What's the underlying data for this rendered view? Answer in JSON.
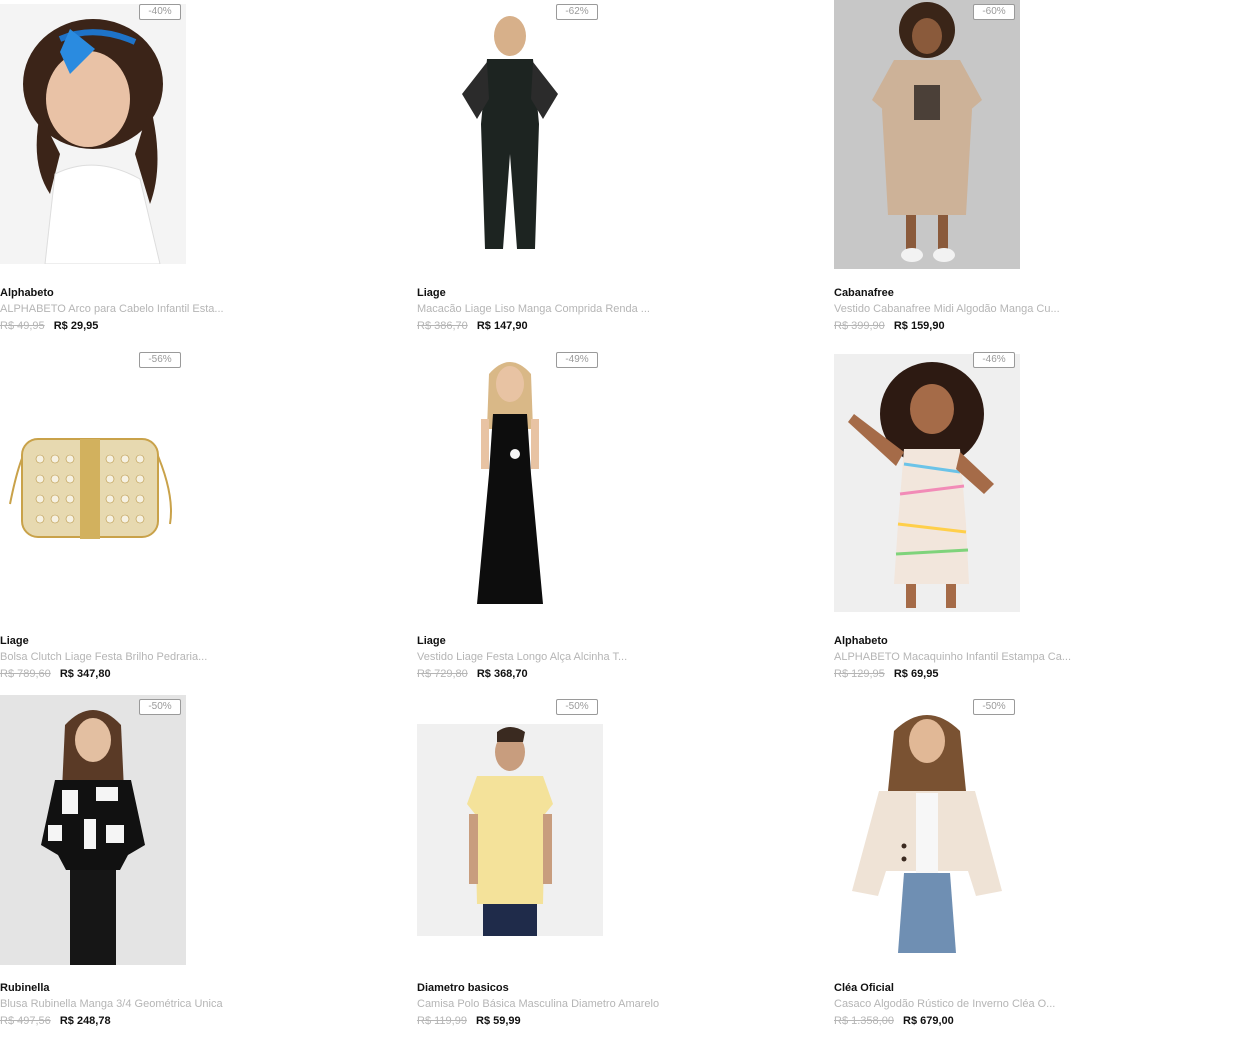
{
  "products": [
    {
      "brand": "Alphabeto",
      "name": "ALPHABETO Arco para Cabelo Infantil Esta...",
      "old_price": "R$ 49,95",
      "price": "R$ 29,95",
      "discount": "-40%",
      "image": "girl-blue-bow-photo",
      "bg": "#f3f3f3"
    },
    {
      "brand": "Liage",
      "name": "Macacão Liage Liso Manga Comprida Renda ...",
      "old_price": "R$ 386,70",
      "price": "R$ 147,90",
      "discount": "-62%",
      "image": "black-jumpsuit-photo",
      "bg": "#ffffff"
    },
    {
      "brand": "Cabanafree",
      "name": "Vestido Cabanafree Midi Algodão Manga Cu...",
      "old_price": "R$ 399,90",
      "price": "R$ 159,90",
      "discount": "-60%",
      "image": "beige-tshirt-dress-photo",
      "bg": "#c9c9c9"
    },
    {
      "brand": "Liage",
      "name": "Bolsa Clutch Liage Festa Brilho Pedraria...",
      "old_price": "R$ 789,60",
      "price": "R$ 347,80",
      "discount": "-56%",
      "image": "pearl-clutch-photo",
      "bg": "#ffffff"
    },
    {
      "brand": "Liage",
      "name": "Vestido Liage Festa Longo Alça Alcinha T...",
      "old_price": "R$ 729,80",
      "price": "R$ 368,70",
      "discount": "-49%",
      "image": "black-long-dress-photo",
      "bg": "#ffffff"
    },
    {
      "brand": "Alphabeto",
      "name": "ALPHABETO Macaquinho Infantil Estampa Ca...",
      "old_price": "R$ 129,95",
      "price": "R$ 69,95",
      "discount": "-46%",
      "image": "girl-print-romper-photo",
      "bg": "#eeeeee"
    },
    {
      "brand": "Rubinella",
      "name": "Blusa Rubinella Manga 3/4 Geométrica Unica",
      "old_price": "R$ 497,56",
      "price": "R$ 248,78",
      "discount": "-50%",
      "image": "geometric-blouse-photo",
      "bg": "#e6e6e6"
    },
    {
      "brand": "Diametro basicos",
      "name": "Camisa Polo Básica Masculina Diametro Amarelo",
      "old_price": "R$ 119,99",
      "price": "R$ 59,99",
      "discount": "-50%",
      "image": "yellow-polo-photo",
      "bg": "#f1f1f1"
    },
    {
      "brand": "Cléa Oficial",
      "name": "Casaco Algodão Rústico de Inverno Cléa O...",
      "old_price": "R$ 1.358,00",
      "price": "R$ 679,00",
      "discount": "-50%",
      "image": "beige-coat-photo",
      "bg": "#ffffff"
    }
  ]
}
